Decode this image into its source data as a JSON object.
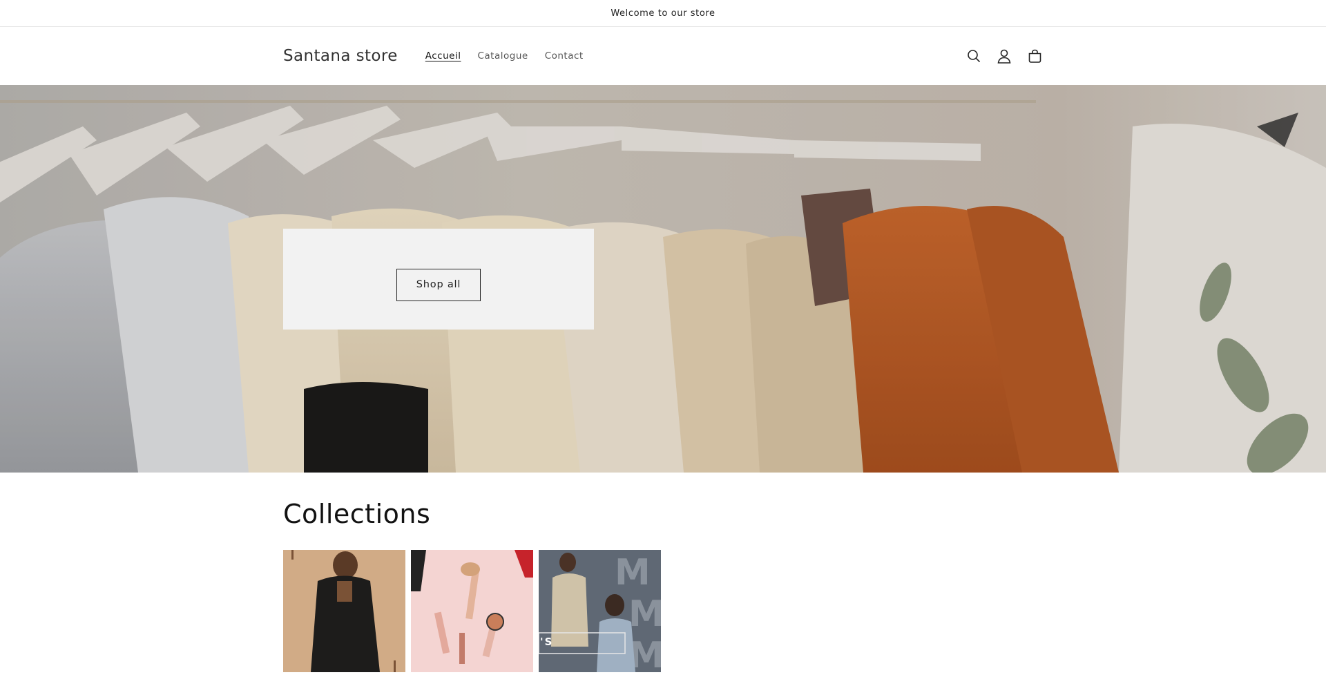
{
  "announcement": {
    "text": "Welcome to our store"
  },
  "header": {
    "brand": "Santana store",
    "nav": [
      {
        "label": "Accueil",
        "active": true
      },
      {
        "label": "Catalogue",
        "active": false
      },
      {
        "label": "Contact",
        "active": false
      }
    ],
    "icons": [
      "search-icon",
      "account-icon",
      "cart-icon"
    ]
  },
  "hero": {
    "button_label": "Shop all"
  },
  "collections": {
    "title": "Collections",
    "cards": [
      {
        "image": "woman-black-cardigan"
      },
      {
        "image": "makeup-brushes-pink"
      },
      {
        "image": "men-fashion-grey",
        "overlay_text": "'S"
      }
    ]
  },
  "colors": {
    "accent_orange": "#c0622b",
    "cream": "#efe3cc",
    "text": "#121212"
  }
}
